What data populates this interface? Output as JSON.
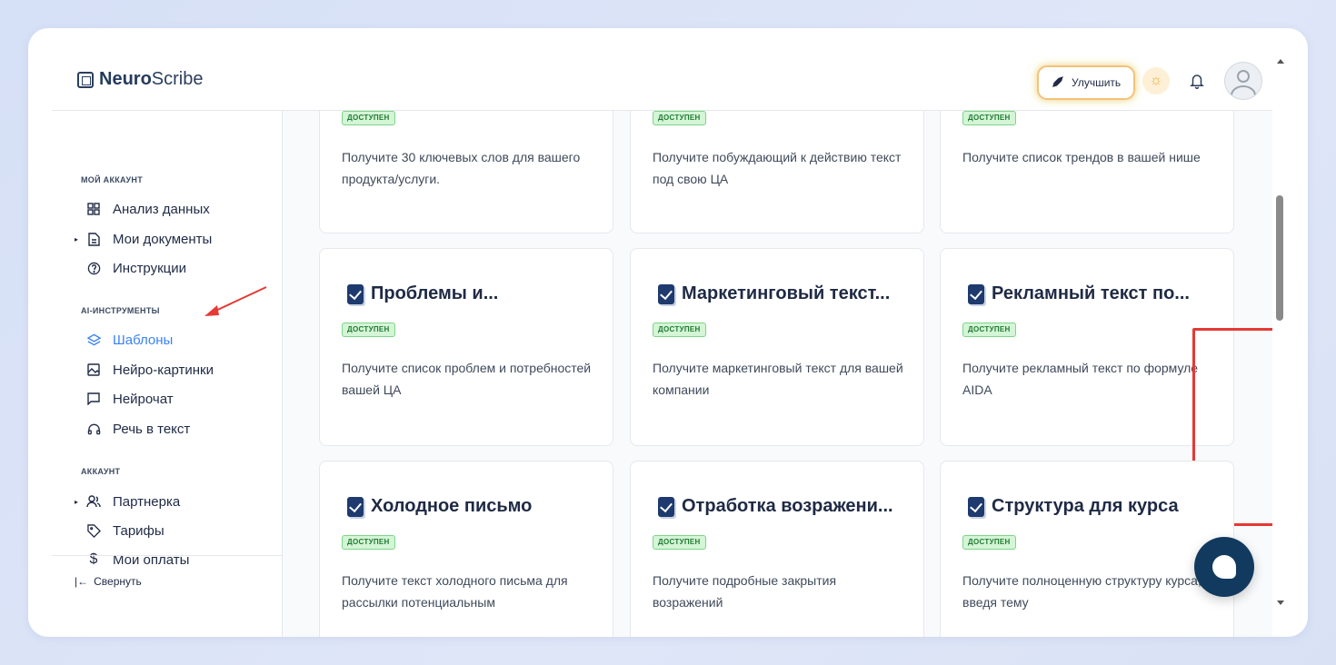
{
  "app": {
    "brand_bold": "Neuro",
    "brand_rest": "Scribe"
  },
  "header": {
    "upgrade_label": "Улучшить"
  },
  "sidebar": {
    "sections": [
      {
        "title": "МОЙ АККАУНТ"
      },
      {
        "title": "AI-ИНСТРУМЕНТЫ"
      },
      {
        "title": "АККАУНТ"
      }
    ],
    "items": [
      {
        "label": "Анализ данных",
        "icon": "grid-icon"
      },
      {
        "label": "Мои документы",
        "icon": "document-icon"
      },
      {
        "label": "Инструкции",
        "icon": "help-circle-icon"
      },
      {
        "label": "Шаблоны",
        "icon": "layers-icon",
        "active": true
      },
      {
        "label": "Нейро-картинки",
        "icon": "image-icon"
      },
      {
        "label": "Нейрочат",
        "icon": "chat-icon"
      },
      {
        "label": "Речь в текст",
        "icon": "headphones-icon"
      },
      {
        "label": "Партнерка",
        "icon": "users-icon"
      },
      {
        "label": "Тарифы",
        "icon": "tag-icon"
      },
      {
        "label": "Мои оплаты",
        "icon": "dollar-icon"
      }
    ],
    "collapse_label": "Свернуть"
  },
  "badge_label": "ДОСТУПЕН",
  "cards": [
    {
      "title": "",
      "desc": "Получите 30 ключевых слов для вашего продукта/услуги."
    },
    {
      "title": "",
      "desc": "Получите побуждающий к действию текст под свою ЦА"
    },
    {
      "title": "",
      "desc": "Получите список трендов в вашей нише"
    },
    {
      "title": "Проблемы и...",
      "desc": "Получите список проблем и потребностей вашей ЦА"
    },
    {
      "title": "Маркетинговый текст...",
      "desc": "Получите маркетинговый текст для вашей компании"
    },
    {
      "title": "Рекламный текст по...",
      "desc": "Получите рекламный текст по формуле AIDA"
    },
    {
      "title": "Холодное письмо",
      "desc": "Получите текст холодного письма для рассылки потенциальным"
    },
    {
      "title": "Отработка возражени...",
      "desc": "Получите подробные закрытия возражений"
    },
    {
      "title": "Структура для курса",
      "desc": "Получите полноценную структуру курса, введя тему"
    }
  ],
  "colors": {
    "accent": "#3b82f6",
    "highlight": "#e53935",
    "badge_bg": "#d4f5d6",
    "chat_button": "#123a5e"
  }
}
